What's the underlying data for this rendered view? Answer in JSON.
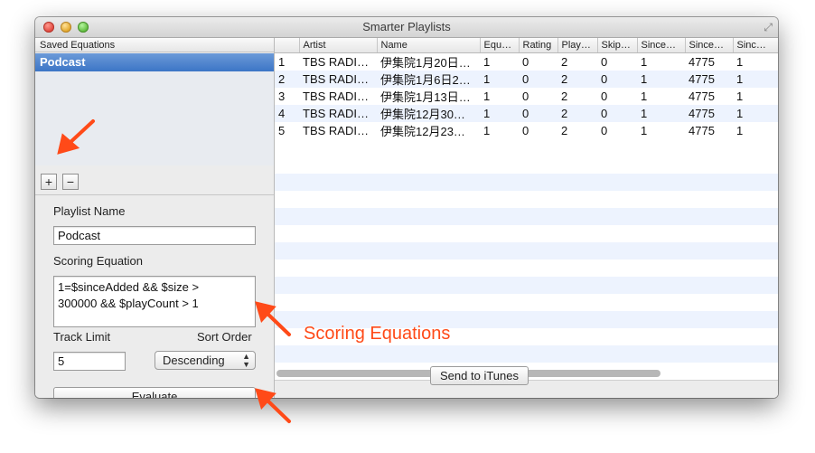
{
  "window": {
    "title": "Smarter Playlists"
  },
  "saved_equations": {
    "header": "Saved Equations",
    "items": [
      "Podcast"
    ],
    "add_label": "+",
    "remove_label": "−"
  },
  "form": {
    "playlist_name_label": "Playlist Name",
    "playlist_name_value": "Podcast",
    "scoring_equation_label": "Scoring Equation",
    "scoring_equation_lines": [
      "1=$sinceAdded && $size >",
      "300000 && $playCount > 1"
    ],
    "track_limit_label": "Track Limit",
    "track_limit_value": "5",
    "sort_order_label": "Sort Order",
    "sort_order_value": "Descending",
    "evaluate_label": "Evaluate"
  },
  "table": {
    "columns": [
      "",
      "Artist",
      "Name",
      "Equ…",
      "Rating",
      "Play…",
      "Skip…",
      "Since…",
      "Since…",
      "Sinc…"
    ],
    "rows": [
      [
        "1",
        "TBS RADI…",
        "伊集院1月20日…",
        "1",
        "0",
        "2",
        "0",
        "1",
        "4775",
        "1"
      ],
      [
        "2",
        "TBS RADI…",
        "伊集院1月6日2…",
        "1",
        "0",
        "2",
        "0",
        "1",
        "4775",
        "1"
      ],
      [
        "3",
        "TBS RADI…",
        "伊集院1月13日…",
        "1",
        "0",
        "2",
        "0",
        "1",
        "4775",
        "1"
      ],
      [
        "4",
        "TBS RADI…",
        "伊集院12月30…",
        "1",
        "0",
        "2",
        "0",
        "1",
        "4775",
        "1"
      ],
      [
        "5",
        "TBS RADI…",
        "伊集院12月23…",
        "1",
        "0",
        "2",
        "0",
        "1",
        "4775",
        "1"
      ]
    ]
  },
  "send_button_label": "Send to iTunes",
  "annotation": {
    "text": "Scoring Equations",
    "color": "#ff4a18"
  }
}
